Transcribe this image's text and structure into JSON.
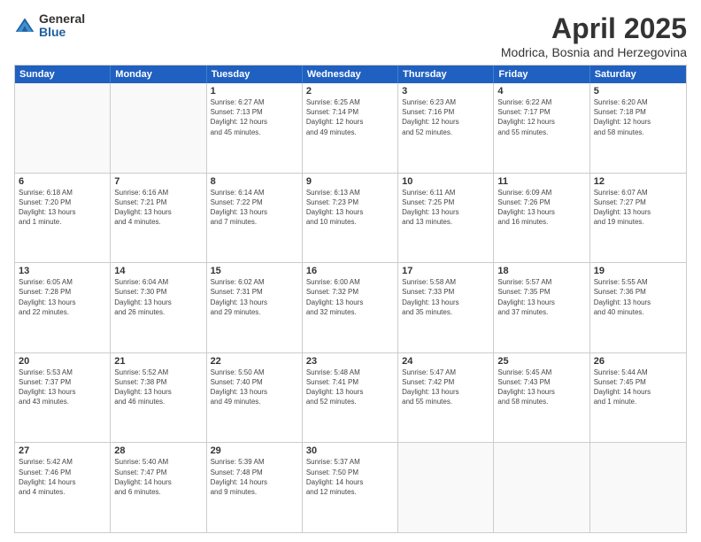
{
  "logo": {
    "general": "General",
    "blue": "Blue"
  },
  "title": "April 2025",
  "subtitle": "Modrica, Bosnia and Herzegovina",
  "header": {
    "days": [
      "Sunday",
      "Monday",
      "Tuesday",
      "Wednesday",
      "Thursday",
      "Friday",
      "Saturday"
    ]
  },
  "weeks": [
    [
      {
        "day": "",
        "info": ""
      },
      {
        "day": "",
        "info": ""
      },
      {
        "day": "1",
        "info": "Sunrise: 6:27 AM\nSunset: 7:13 PM\nDaylight: 12 hours\nand 45 minutes."
      },
      {
        "day": "2",
        "info": "Sunrise: 6:25 AM\nSunset: 7:14 PM\nDaylight: 12 hours\nand 49 minutes."
      },
      {
        "day": "3",
        "info": "Sunrise: 6:23 AM\nSunset: 7:16 PM\nDaylight: 12 hours\nand 52 minutes."
      },
      {
        "day": "4",
        "info": "Sunrise: 6:22 AM\nSunset: 7:17 PM\nDaylight: 12 hours\nand 55 minutes."
      },
      {
        "day": "5",
        "info": "Sunrise: 6:20 AM\nSunset: 7:18 PM\nDaylight: 12 hours\nand 58 minutes."
      }
    ],
    [
      {
        "day": "6",
        "info": "Sunrise: 6:18 AM\nSunset: 7:20 PM\nDaylight: 13 hours\nand 1 minute."
      },
      {
        "day": "7",
        "info": "Sunrise: 6:16 AM\nSunset: 7:21 PM\nDaylight: 13 hours\nand 4 minutes."
      },
      {
        "day": "8",
        "info": "Sunrise: 6:14 AM\nSunset: 7:22 PM\nDaylight: 13 hours\nand 7 minutes."
      },
      {
        "day": "9",
        "info": "Sunrise: 6:13 AM\nSunset: 7:23 PM\nDaylight: 13 hours\nand 10 minutes."
      },
      {
        "day": "10",
        "info": "Sunrise: 6:11 AM\nSunset: 7:25 PM\nDaylight: 13 hours\nand 13 minutes."
      },
      {
        "day": "11",
        "info": "Sunrise: 6:09 AM\nSunset: 7:26 PM\nDaylight: 13 hours\nand 16 minutes."
      },
      {
        "day": "12",
        "info": "Sunrise: 6:07 AM\nSunset: 7:27 PM\nDaylight: 13 hours\nand 19 minutes."
      }
    ],
    [
      {
        "day": "13",
        "info": "Sunrise: 6:05 AM\nSunset: 7:28 PM\nDaylight: 13 hours\nand 22 minutes."
      },
      {
        "day": "14",
        "info": "Sunrise: 6:04 AM\nSunset: 7:30 PM\nDaylight: 13 hours\nand 26 minutes."
      },
      {
        "day": "15",
        "info": "Sunrise: 6:02 AM\nSunset: 7:31 PM\nDaylight: 13 hours\nand 29 minutes."
      },
      {
        "day": "16",
        "info": "Sunrise: 6:00 AM\nSunset: 7:32 PM\nDaylight: 13 hours\nand 32 minutes."
      },
      {
        "day": "17",
        "info": "Sunrise: 5:58 AM\nSunset: 7:33 PM\nDaylight: 13 hours\nand 35 minutes."
      },
      {
        "day": "18",
        "info": "Sunrise: 5:57 AM\nSunset: 7:35 PM\nDaylight: 13 hours\nand 37 minutes."
      },
      {
        "day": "19",
        "info": "Sunrise: 5:55 AM\nSunset: 7:36 PM\nDaylight: 13 hours\nand 40 minutes."
      }
    ],
    [
      {
        "day": "20",
        "info": "Sunrise: 5:53 AM\nSunset: 7:37 PM\nDaylight: 13 hours\nand 43 minutes."
      },
      {
        "day": "21",
        "info": "Sunrise: 5:52 AM\nSunset: 7:38 PM\nDaylight: 13 hours\nand 46 minutes."
      },
      {
        "day": "22",
        "info": "Sunrise: 5:50 AM\nSunset: 7:40 PM\nDaylight: 13 hours\nand 49 minutes."
      },
      {
        "day": "23",
        "info": "Sunrise: 5:48 AM\nSunset: 7:41 PM\nDaylight: 13 hours\nand 52 minutes."
      },
      {
        "day": "24",
        "info": "Sunrise: 5:47 AM\nSunset: 7:42 PM\nDaylight: 13 hours\nand 55 minutes."
      },
      {
        "day": "25",
        "info": "Sunrise: 5:45 AM\nSunset: 7:43 PM\nDaylight: 13 hours\nand 58 minutes."
      },
      {
        "day": "26",
        "info": "Sunrise: 5:44 AM\nSunset: 7:45 PM\nDaylight: 14 hours\nand 1 minute."
      }
    ],
    [
      {
        "day": "27",
        "info": "Sunrise: 5:42 AM\nSunset: 7:46 PM\nDaylight: 14 hours\nand 4 minutes."
      },
      {
        "day": "28",
        "info": "Sunrise: 5:40 AM\nSunset: 7:47 PM\nDaylight: 14 hours\nand 6 minutes."
      },
      {
        "day": "29",
        "info": "Sunrise: 5:39 AM\nSunset: 7:48 PM\nDaylight: 14 hours\nand 9 minutes."
      },
      {
        "day": "30",
        "info": "Sunrise: 5:37 AM\nSunset: 7:50 PM\nDaylight: 14 hours\nand 12 minutes."
      },
      {
        "day": "",
        "info": ""
      },
      {
        "day": "",
        "info": ""
      },
      {
        "day": "",
        "info": ""
      }
    ]
  ]
}
